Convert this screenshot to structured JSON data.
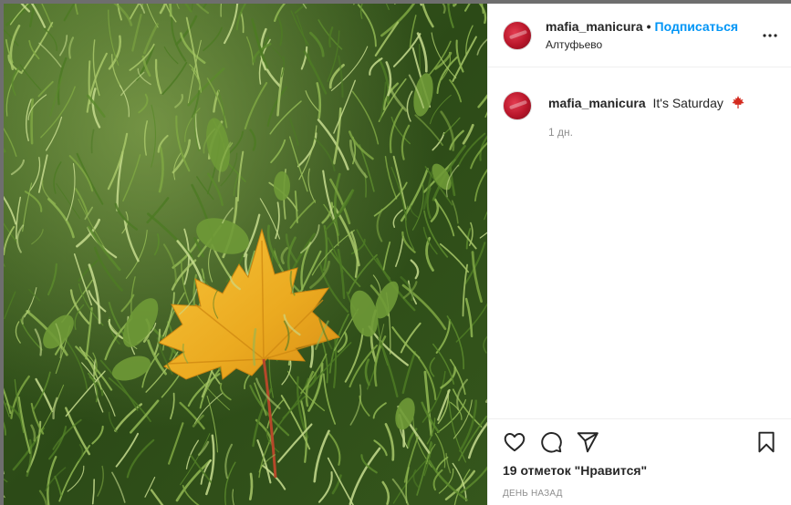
{
  "post": {
    "username": "mafia_manicura",
    "separator": "•",
    "follow_label": "Подписаться",
    "location": "Алтуфьево",
    "more_icon": "more-horizontal-icon"
  },
  "comment": {
    "username": "mafia_manicura",
    "text": "It's Saturday",
    "emoji_icon": "maple-leaf-emoji-icon",
    "time": "1 дн."
  },
  "actions": {
    "like_icon": "heart-icon",
    "comment_icon": "comment-icon",
    "share_icon": "share-icon",
    "save_icon": "bookmark-icon",
    "likes_text": "19 отметок \"Нравится\"",
    "date_text": "ДЕНЬ НАЗАД"
  },
  "colors": {
    "accent": "#0095f6",
    "text": "#262626",
    "muted": "#8e8e8e",
    "leaf": "#f0b22a",
    "grass": "#3f6a22"
  }
}
